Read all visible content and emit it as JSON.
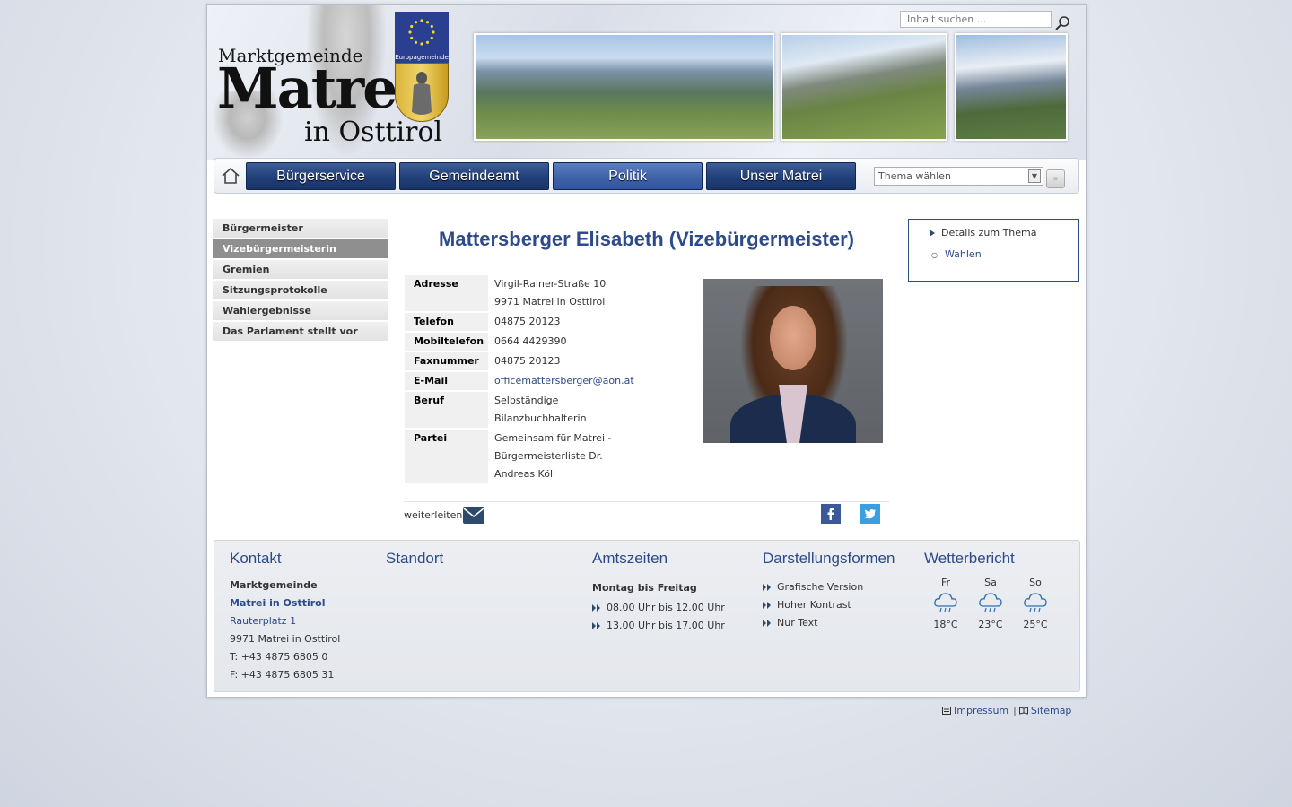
{
  "header": {
    "logo_small": "Marktgemeinde",
    "logo_big": "Matrei",
    "logo_sub": "in Osttirol",
    "crest_label": "Europagemeinde",
    "search_placeholder": "Inhalt suchen ..."
  },
  "nav": {
    "items": [
      {
        "label": "Bürgerservice",
        "active": false
      },
      {
        "label": "Gemeindeamt",
        "active": false
      },
      {
        "label": "Politik",
        "active": true
      },
      {
        "label": "Unser Matrei",
        "active": false
      }
    ],
    "select_value": "Thema wählen"
  },
  "sidebar": {
    "items": [
      {
        "label": "Bürgermeister",
        "active": false
      },
      {
        "label": "Vizebürgermeisterin",
        "active": true
      },
      {
        "label": "Gremien",
        "active": false
      },
      {
        "label": "Sitzungsprotokolle",
        "active": false
      },
      {
        "label": "Wahlergebnisse",
        "active": false
      },
      {
        "label": "Das Parlament stellt vor",
        "active": false
      }
    ]
  },
  "main": {
    "title": "Mattersberger Elisabeth (Vizebürgermeister)",
    "rows": [
      {
        "label": "Adresse",
        "lines": [
          "Virgil-Rainer-Straße 10",
          "9971 Matrei in Osttirol"
        ]
      },
      {
        "label": "Telefon",
        "lines": [
          "04875 20123"
        ]
      },
      {
        "label": "Mobiltelefon",
        "lines": [
          "0664 4429390"
        ]
      },
      {
        "label": "Faxnummer",
        "lines": [
          "04875 20123"
        ]
      },
      {
        "label": "E-Mail",
        "lines": [
          "officemattersberger@aon.at"
        ]
      },
      {
        "label": "Beruf",
        "lines": [
          "Selbständige",
          "Bilanzbuchhalterin"
        ]
      },
      {
        "label": "Partei",
        "lines": [
          "Gemeinsam für Matrei -",
          "Bürgermeisterliste Dr.",
          "Andreas Köll"
        ]
      }
    ],
    "forward_label": "weiterleiten"
  },
  "rightbox": {
    "heading": "Details zum Thema",
    "link": "Wahlen"
  },
  "footer": {
    "kontakt": {
      "heading": "Kontakt",
      "line1": "Marktgemeinde",
      "line2": "Matrei in Osttirol",
      "line3": "Rauterplatz 1",
      "line4": "9971 Matrei in Osttirol",
      "line5": "T: +43 4875 6805 0",
      "line6": "F: +43 4875 6805 31"
    },
    "standort": {
      "heading": "Standort"
    },
    "amtszeiten": {
      "heading": "Amtszeiten",
      "days": "Montag bis Freitag",
      "t1": "08.00 Uhr bis 12.00 Uhr",
      "t2": "13.00 Uhr bis 17.00 Uhr"
    },
    "darstellung": {
      "heading": "Darstellungsformen",
      "o1": "Grafische Version",
      "o2": "Hoher Kontrast",
      "o3": "Nur Text"
    },
    "wetter": {
      "heading": "Wetterbericht",
      "days": [
        {
          "day": "Fr",
          "temp": "18°C"
        },
        {
          "day": "Sa",
          "temp": "23°C"
        },
        {
          "day": "So",
          "temp": "25°C"
        }
      ]
    }
  },
  "bottom": {
    "impressum": "Impressum",
    "separator": "|",
    "sitemap": "Sitemap"
  },
  "colors": {
    "accent": "#2d4a8a",
    "nav_button": "#213f78",
    "nav_button_active": "#3f63a8"
  },
  "icons": [
    "search-icon",
    "home-icon",
    "mail-icon",
    "facebook-icon",
    "twitter-icon",
    "cloud-rain-icon",
    "triangle-bullet-icon",
    "double-chevron-icon"
  ]
}
